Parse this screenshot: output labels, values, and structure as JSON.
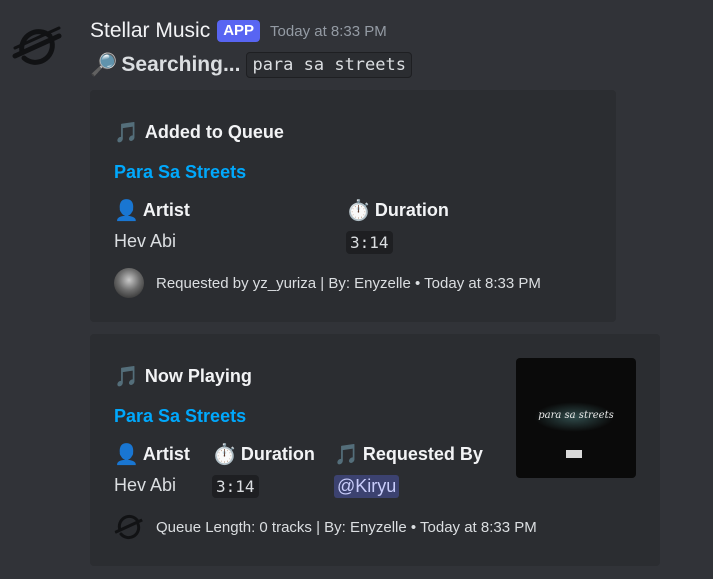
{
  "message": {
    "username": "Stellar Music",
    "badge": "APP",
    "timestamp": "Today at 8:33 PM",
    "search_emoji": "🔎",
    "search_text": "Searching...",
    "search_query": "para sa streets"
  },
  "embed_queue": {
    "title_emoji": "🎵",
    "title": "Added to Queue",
    "track": "Para Sa Streets",
    "fields": [
      {
        "emoji": "👤",
        "name": "Artist",
        "value": "Hev Abi"
      },
      {
        "emoji": "⏱️",
        "name": "Duration",
        "value": "3:14"
      }
    ],
    "footer": "Requested by yz_yuriza | By: Enyzelle • Today at 8:33 PM"
  },
  "embed_now": {
    "title_emoji": "🎵",
    "title": "Now Playing",
    "track": "Para Sa Streets",
    "fields": [
      {
        "emoji": "👤",
        "name": "Artist",
        "value": "Hev Abi"
      },
      {
        "emoji": "⏱️",
        "name": "Duration",
        "value": "3:14"
      },
      {
        "emoji": "🎵",
        "name": "Requested By",
        "value": "@Kiryu"
      }
    ],
    "thumbnail_text": "para sa streets",
    "footer": "Queue Length: 0 tracks | By: Enyzelle • Today at 8:33 PM"
  },
  "colors": {
    "background": "#313338",
    "embed": "#2b2d31",
    "link": "#00a8fc",
    "badge": "#5865f2",
    "mention": "#3c4270"
  }
}
